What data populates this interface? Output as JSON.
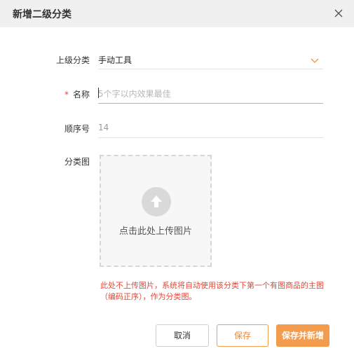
{
  "dialog": {
    "title": "新增二级分类",
    "close_icon": "close-icon"
  },
  "form": {
    "parent_category": {
      "label": "上级分类",
      "value": "手动工具",
      "icon": "chevron-down-icon"
    },
    "name": {
      "required_mark": "*",
      "label": "名称",
      "value": "",
      "placeholder": "5个字以内效果最佳"
    },
    "order": {
      "label": "顺序号",
      "value": "14"
    },
    "image": {
      "label": "分类图",
      "upload_text": "点击此处上传图片",
      "upload_icon": "upload-arrow-icon"
    },
    "hint": "此处不上传图片，系统将自动使用该分类下第一个有图商品的主图（编码正序），作为分类图。"
  },
  "buttons": {
    "cancel": "取消",
    "save": "保存",
    "save_and_new": "保存并新增"
  },
  "colors": {
    "accent": "#f39c4e",
    "error_text": "#e04a3b",
    "header_bg": "#f0f0f0"
  }
}
